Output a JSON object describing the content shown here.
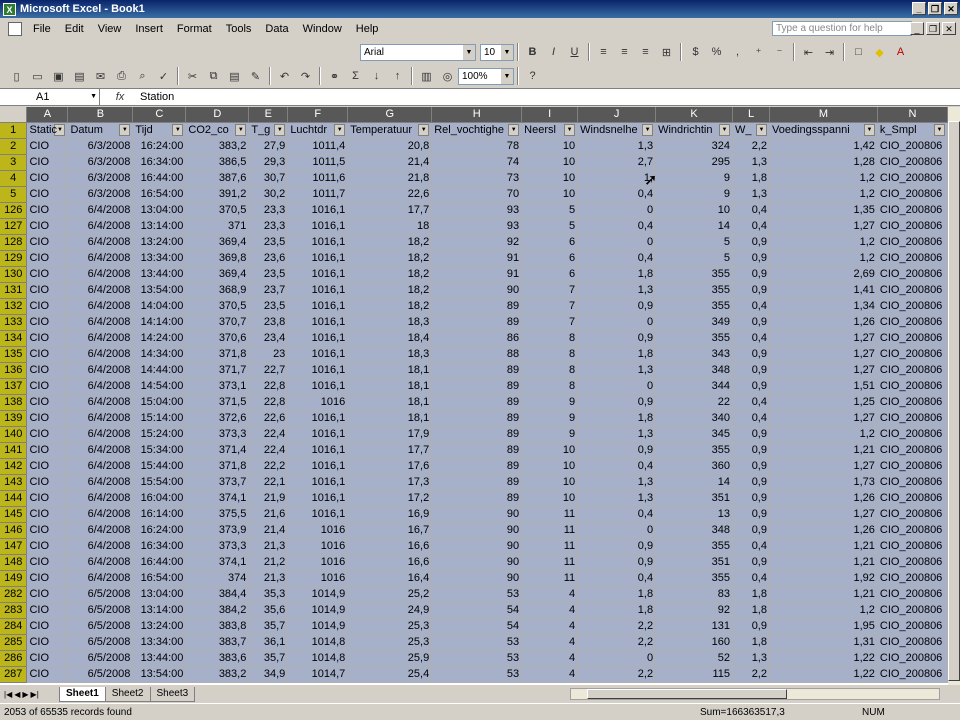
{
  "window": {
    "title": "Microsoft Excel - Book1",
    "app_icon": "X"
  },
  "menu": [
    "File",
    "Edit",
    "View",
    "Insert",
    "Format",
    "Tools",
    "Data",
    "Window",
    "Help"
  ],
  "help_placeholder": "Type a question for help",
  "font": {
    "name": "Arial",
    "size": "10"
  },
  "zoom": "100%",
  "formula_bar": {
    "name_box": "A1",
    "fx": "fx",
    "content": "Station"
  },
  "columns": [
    "A",
    "B",
    "C",
    "D",
    "E",
    "F",
    "G",
    "H",
    "I",
    "J",
    "K",
    "L",
    "M",
    "N"
  ],
  "header_row": {
    "num": "1",
    "cells": [
      "Static",
      "Datum",
      "Tijd",
      "CO2_co",
      "T_g",
      "Luchtdr",
      "Temperatuur",
      "Rel_vochtighe",
      "Neersl",
      "Windsnelhe",
      "Windrichtin",
      "W_",
      "Voedingsspanni",
      "k_Smpl"
    ]
  },
  "rows": [
    [
      "2",
      "CIO",
      "6/3/2008",
      "16:24:00",
      "383,2",
      "27,9",
      "1011,4",
      "20,8",
      "78",
      "10",
      "1,3",
      "324",
      "2,2",
      "1,42",
      "CIO_200806"
    ],
    [
      "3",
      "CIO",
      "6/3/2008",
      "16:34:00",
      "386,5",
      "29,3",
      "1011,5",
      "21,4",
      "74",
      "10",
      "2,7",
      "295",
      "1,3",
      "1,28",
      "CIO_200806"
    ],
    [
      "4",
      "CIO",
      "6/3/2008",
      "16:44:00",
      "387,6",
      "30,7",
      "1011,6",
      "21,8",
      "73",
      "10",
      "1,",
      "9",
      "1,8",
      "1,2",
      "CIO_200806"
    ],
    [
      "5",
      "CIO",
      "6/3/2008",
      "16:54:00",
      "391,2",
      "30,2",
      "1011,7",
      "22,6",
      "70",
      "10",
      "0,4",
      "9",
      "1,3",
      "1,2",
      "CIO_200806"
    ],
    [
      "126",
      "CIO",
      "6/4/2008",
      "13:04:00",
      "370,5",
      "23,3",
      "1016,1",
      "17,7",
      "93",
      "5",
      "0",
      "10",
      "0,4",
      "1,35",
      "CIO_200806"
    ],
    [
      "127",
      "CIO",
      "6/4/2008",
      "13:14:00",
      "371",
      "23,3",
      "1016,1",
      "18",
      "93",
      "5",
      "0,4",
      "14",
      "0,4",
      "1,27",
      "CIO_200806"
    ],
    [
      "128",
      "CIO",
      "6/4/2008",
      "13:24:00",
      "369,4",
      "23,5",
      "1016,1",
      "18,2",
      "92",
      "6",
      "0",
      "5",
      "0,9",
      "1,2",
      "CIO_200806"
    ],
    [
      "129",
      "CIO",
      "6/4/2008",
      "13:34:00",
      "369,8",
      "23,6",
      "1016,1",
      "18,2",
      "91",
      "6",
      "0,4",
      "5",
      "0,9",
      "1,2",
      "CIO_200806"
    ],
    [
      "130",
      "CIO",
      "6/4/2008",
      "13:44:00",
      "369,4",
      "23,5",
      "1016,1",
      "18,2",
      "91",
      "6",
      "1,8",
      "355",
      "0,9",
      "2,69",
      "CIO_200806"
    ],
    [
      "131",
      "CIO",
      "6/4/2008",
      "13:54:00",
      "368,9",
      "23,7",
      "1016,1",
      "18,2",
      "90",
      "7",
      "1,3",
      "355",
      "0,9",
      "1,41",
      "CIO_200806"
    ],
    [
      "132",
      "CIO",
      "6/4/2008",
      "14:04:00",
      "370,5",
      "23,5",
      "1016,1",
      "18,2",
      "89",
      "7",
      "0,9",
      "355",
      "0,4",
      "1,34",
      "CIO_200806"
    ],
    [
      "133",
      "CIO",
      "6/4/2008",
      "14:14:00",
      "370,7",
      "23,8",
      "1016,1",
      "18,3",
      "89",
      "7",
      "0",
      "349",
      "0,9",
      "1,26",
      "CIO_200806"
    ],
    [
      "134",
      "CIO",
      "6/4/2008",
      "14:24:00",
      "370,6",
      "23,4",
      "1016,1",
      "18,4",
      "86",
      "8",
      "0,9",
      "355",
      "0,4",
      "1,27",
      "CIO_200806"
    ],
    [
      "135",
      "CIO",
      "6/4/2008",
      "14:34:00",
      "371,8",
      "23",
      "1016,1",
      "18,3",
      "88",
      "8",
      "1,8",
      "343",
      "0,9",
      "1,27",
      "CIO_200806"
    ],
    [
      "136",
      "CIO",
      "6/4/2008",
      "14:44:00",
      "371,7",
      "22,7",
      "1016,1",
      "18,1",
      "89",
      "8",
      "1,3",
      "348",
      "0,9",
      "1,27",
      "CIO_200806"
    ],
    [
      "137",
      "CIO",
      "6/4/2008",
      "14:54:00",
      "373,1",
      "22,8",
      "1016,1",
      "18,1",
      "89",
      "8",
      "0",
      "344",
      "0,9",
      "1,51",
      "CIO_200806"
    ],
    [
      "138",
      "CIO",
      "6/4/2008",
      "15:04:00",
      "371,5",
      "22,8",
      "1016",
      "18,1",
      "89",
      "9",
      "0,9",
      "22",
      "0,4",
      "1,25",
      "CIO_200806"
    ],
    [
      "139",
      "CIO",
      "6/4/2008",
      "15:14:00",
      "372,6",
      "22,6",
      "1016,1",
      "18,1",
      "89",
      "9",
      "1,8",
      "340",
      "0,4",
      "1,27",
      "CIO_200806"
    ],
    [
      "140",
      "CIO",
      "6/4/2008",
      "15:24:00",
      "373,3",
      "22,4",
      "1016,1",
      "17,9",
      "89",
      "9",
      "1,3",
      "345",
      "0,9",
      "1,2",
      "CIO_200806"
    ],
    [
      "141",
      "CIO",
      "6/4/2008",
      "15:34:00",
      "371,4",
      "22,4",
      "1016,1",
      "17,7",
      "89",
      "10",
      "0,9",
      "355",
      "0,9",
      "1,21",
      "CIO_200806"
    ],
    [
      "142",
      "CIO",
      "6/4/2008",
      "15:44:00",
      "371,8",
      "22,2",
      "1016,1",
      "17,6",
      "89",
      "10",
      "0,4",
      "360",
      "0,9",
      "1,27",
      "CIO_200806"
    ],
    [
      "143",
      "CIO",
      "6/4/2008",
      "15:54:00",
      "373,7",
      "22,1",
      "1016,1",
      "17,3",
      "89",
      "10",
      "1,3",
      "14",
      "0,9",
      "1,73",
      "CIO_200806"
    ],
    [
      "144",
      "CIO",
      "6/4/2008",
      "16:04:00",
      "374,1",
      "21,9",
      "1016,1",
      "17,2",
      "89",
      "10",
      "1,3",
      "351",
      "0,9",
      "1,26",
      "CIO_200806"
    ],
    [
      "145",
      "CIO",
      "6/4/2008",
      "16:14:00",
      "375,5",
      "21,6",
      "1016,1",
      "16,9",
      "90",
      "11",
      "0,4",
      "13",
      "0,9",
      "1,27",
      "CIO_200806"
    ],
    [
      "146",
      "CIO",
      "6/4/2008",
      "16:24:00",
      "373,9",
      "21,4",
      "1016",
      "16,7",
      "90",
      "11",
      "0",
      "348",
      "0,9",
      "1,26",
      "CIO_200806"
    ],
    [
      "147",
      "CIO",
      "6/4/2008",
      "16:34:00",
      "373,3",
      "21,3",
      "1016",
      "16,6",
      "90",
      "11",
      "0,9",
      "355",
      "0,4",
      "1,21",
      "CIO_200806"
    ],
    [
      "148",
      "CIO",
      "6/4/2008",
      "16:44:00",
      "374,1",
      "21,2",
      "1016",
      "16,6",
      "90",
      "11",
      "0,9",
      "351",
      "0,9",
      "1,21",
      "CIO_200806"
    ],
    [
      "149",
      "CIO",
      "6/4/2008",
      "16:54:00",
      "374",
      "21,3",
      "1016",
      "16,4",
      "90",
      "11",
      "0,4",
      "355",
      "0,4",
      "1,92",
      "CIO_200806"
    ],
    [
      "282",
      "CIO",
      "6/5/2008",
      "13:04:00",
      "384,4",
      "35,3",
      "1014,9",
      "25,2",
      "53",
      "4",
      "1,8",
      "83",
      "1,8",
      "1,21",
      "CIO_200806"
    ],
    [
      "283",
      "CIO",
      "6/5/2008",
      "13:14:00",
      "384,2",
      "35,6",
      "1014,9",
      "24,9",
      "54",
      "4",
      "1,8",
      "92",
      "1,8",
      "1,2",
      "CIO_200806"
    ],
    [
      "284",
      "CIO",
      "6/5/2008",
      "13:24:00",
      "383,8",
      "35,7",
      "1014,9",
      "25,3",
      "54",
      "4",
      "2,2",
      "131",
      "0,9",
      "1,95",
      "CIO_200806"
    ],
    [
      "285",
      "CIO",
      "6/5/2008",
      "13:34:00",
      "383,7",
      "36,1",
      "1014,8",
      "25,3",
      "53",
      "4",
      "2,2",
      "160",
      "1,8",
      "1,31",
      "CIO_200806"
    ],
    [
      "286",
      "CIO",
      "6/5/2008",
      "13:44:00",
      "383,6",
      "35,7",
      "1014,8",
      "25,9",
      "53",
      "4",
      "0",
      "52",
      "1,3",
      "1,22",
      "CIO_200806"
    ],
    [
      "287",
      "CIO",
      "6/5/2008",
      "13:54:00",
      "383,2",
      "34,9",
      "1014,7",
      "25,4",
      "53",
      "4",
      "2,2",
      "115",
      "2,2",
      "1,22",
      "CIO_200806"
    ]
  ],
  "sheets": [
    "Sheet1",
    "Sheet2",
    "Sheet3"
  ],
  "status": {
    "records": "2053 of 65535 records found",
    "sum": "Sum=166363517,3",
    "num": "NUM"
  }
}
